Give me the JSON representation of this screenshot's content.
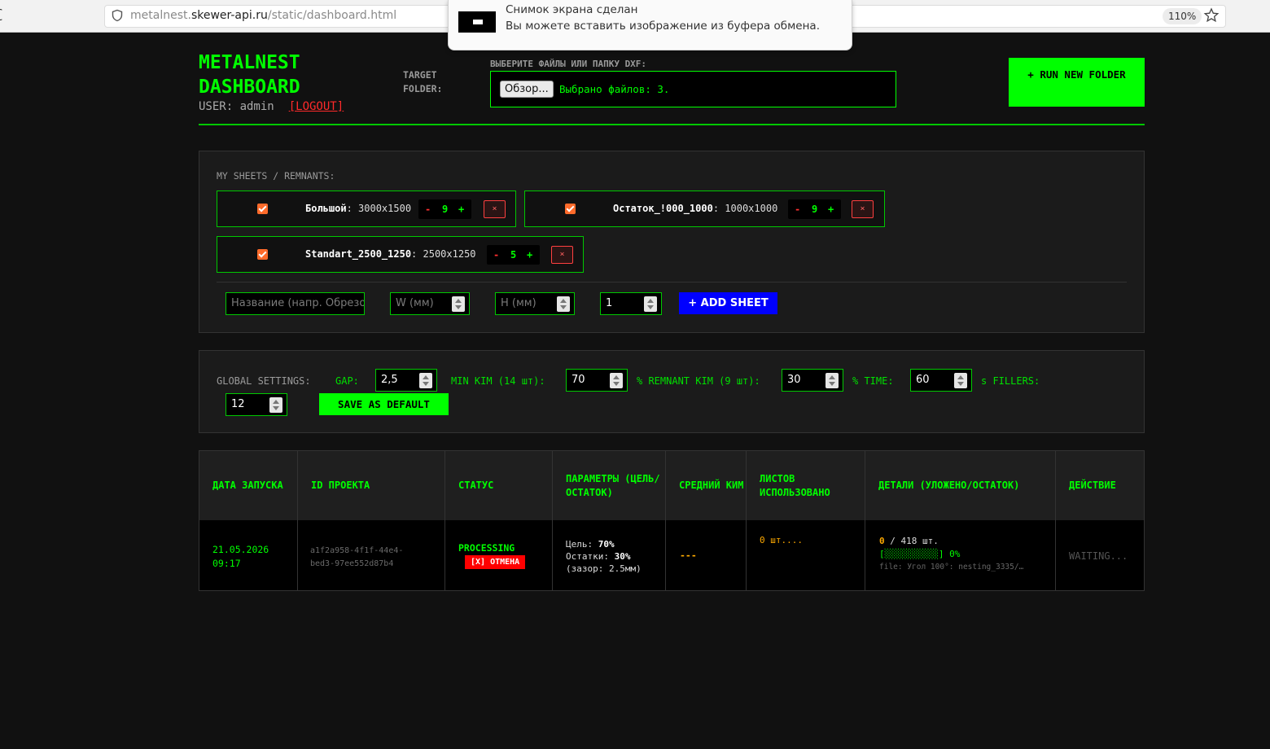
{
  "browser": {
    "reload_fragment": "ʗ",
    "url_prefix": "metalnest.",
    "url_domain": "skewer-api.ru",
    "url_path": "/static/dashboard.html",
    "zoom": "110%"
  },
  "notification": {
    "title": "Снимок экрана сделан",
    "body": "Вы можете вставить изображение из буфера обмена."
  },
  "header": {
    "title": "METALNEST DASHBOARD",
    "user_prefix": "USER: admin",
    "logout": "[LOGOUT]",
    "target_label": "TARGET FOLDER:",
    "files_label": "ВЫБЕРИТЕ ФАЙЛЫ ИЛИ ПАПКУ DXF:",
    "browse_button": "Обзор...",
    "files_selected": "Выбрано файлов: 3.",
    "run_button": "+ RUN NEW FOLDER"
  },
  "sheets": {
    "label": "MY SHEETS / REMNANTS:",
    "items": [
      {
        "name": "Большой",
        "size": ": 3000x1500",
        "qty": "9",
        "checked": true
      },
      {
        "name": "Остаток_!000_1000",
        "size": ": 1000x1000",
        "qty": "9",
        "checked": true
      },
      {
        "name": "Standart_2500_1250",
        "size": ": 2500x1250",
        "qty": "5",
        "checked": true
      }
    ],
    "minus": "-",
    "plus": "+",
    "delete": "×",
    "name_placeholder": "Название (напр. Обрезо",
    "w_placeholder": "W (мм)",
    "h_placeholder": "H (мм)",
    "qty_value": "1",
    "add_button": "+ ADD SHEET"
  },
  "settings": {
    "label": "GLOBAL SETTINGS:",
    "gap_label": "GAP:",
    "gap_value": "2,5",
    "min_kim_label": "MIN KIM (14 шт):",
    "min_kim_value": "70",
    "remnant_label": "% REMNANT KIM (9 шт):",
    "remnant_value": "30",
    "time_label": "% TIME:",
    "time_value": "60",
    "fillers_label": "s FILLERS:",
    "fillers_value": "12",
    "save_button": "SAVE AS DEFAULT"
  },
  "table": {
    "headers": [
      "ДАТА ЗАПУСКА",
      "ID ПРОЕКТА",
      "СТАТУС",
      "ПАРАМЕТРЫ (ЦЕЛЬ/ ОСТАТОК)",
      "СРЕДНИЙ КИМ",
      "ЛИСТОВ ИСПОЛЬЗОВАНО",
      "ДЕТАЛИ (УЛОЖЕНО/ОСТАТОК)",
      "ДЕЙСТВИЕ"
    ],
    "row": {
      "date": "21.05.2026",
      "time": "09:17",
      "id_line1": "a1f2a958-4f1f-44e4-",
      "id_line2": "bed3-97ee552d87b4",
      "status": "PROCESSING",
      "cancel": "[X] ОТМЕНА",
      "target_label": "Цель: ",
      "target_value": "70%",
      "remnant_label": "Остатки: ",
      "remnant_value": "30%",
      "gap_note": "(зазор: 2.5мм)",
      "avg_kim": "---",
      "sheets_used": "0 шт....",
      "placed": "0",
      "total": " / 418 шт.",
      "progress": "[░░░░░░░░░░] 0%",
      "progress_fraction": 0,
      "file": "file: Угол 100°: nesting_3335/…",
      "action": "WAITING..."
    }
  },
  "colors": {
    "accent": "#00ff00",
    "danger": "#ff0000",
    "warning": "#ffaa00",
    "add_button": "#0000ff",
    "background": "#111111"
  }
}
